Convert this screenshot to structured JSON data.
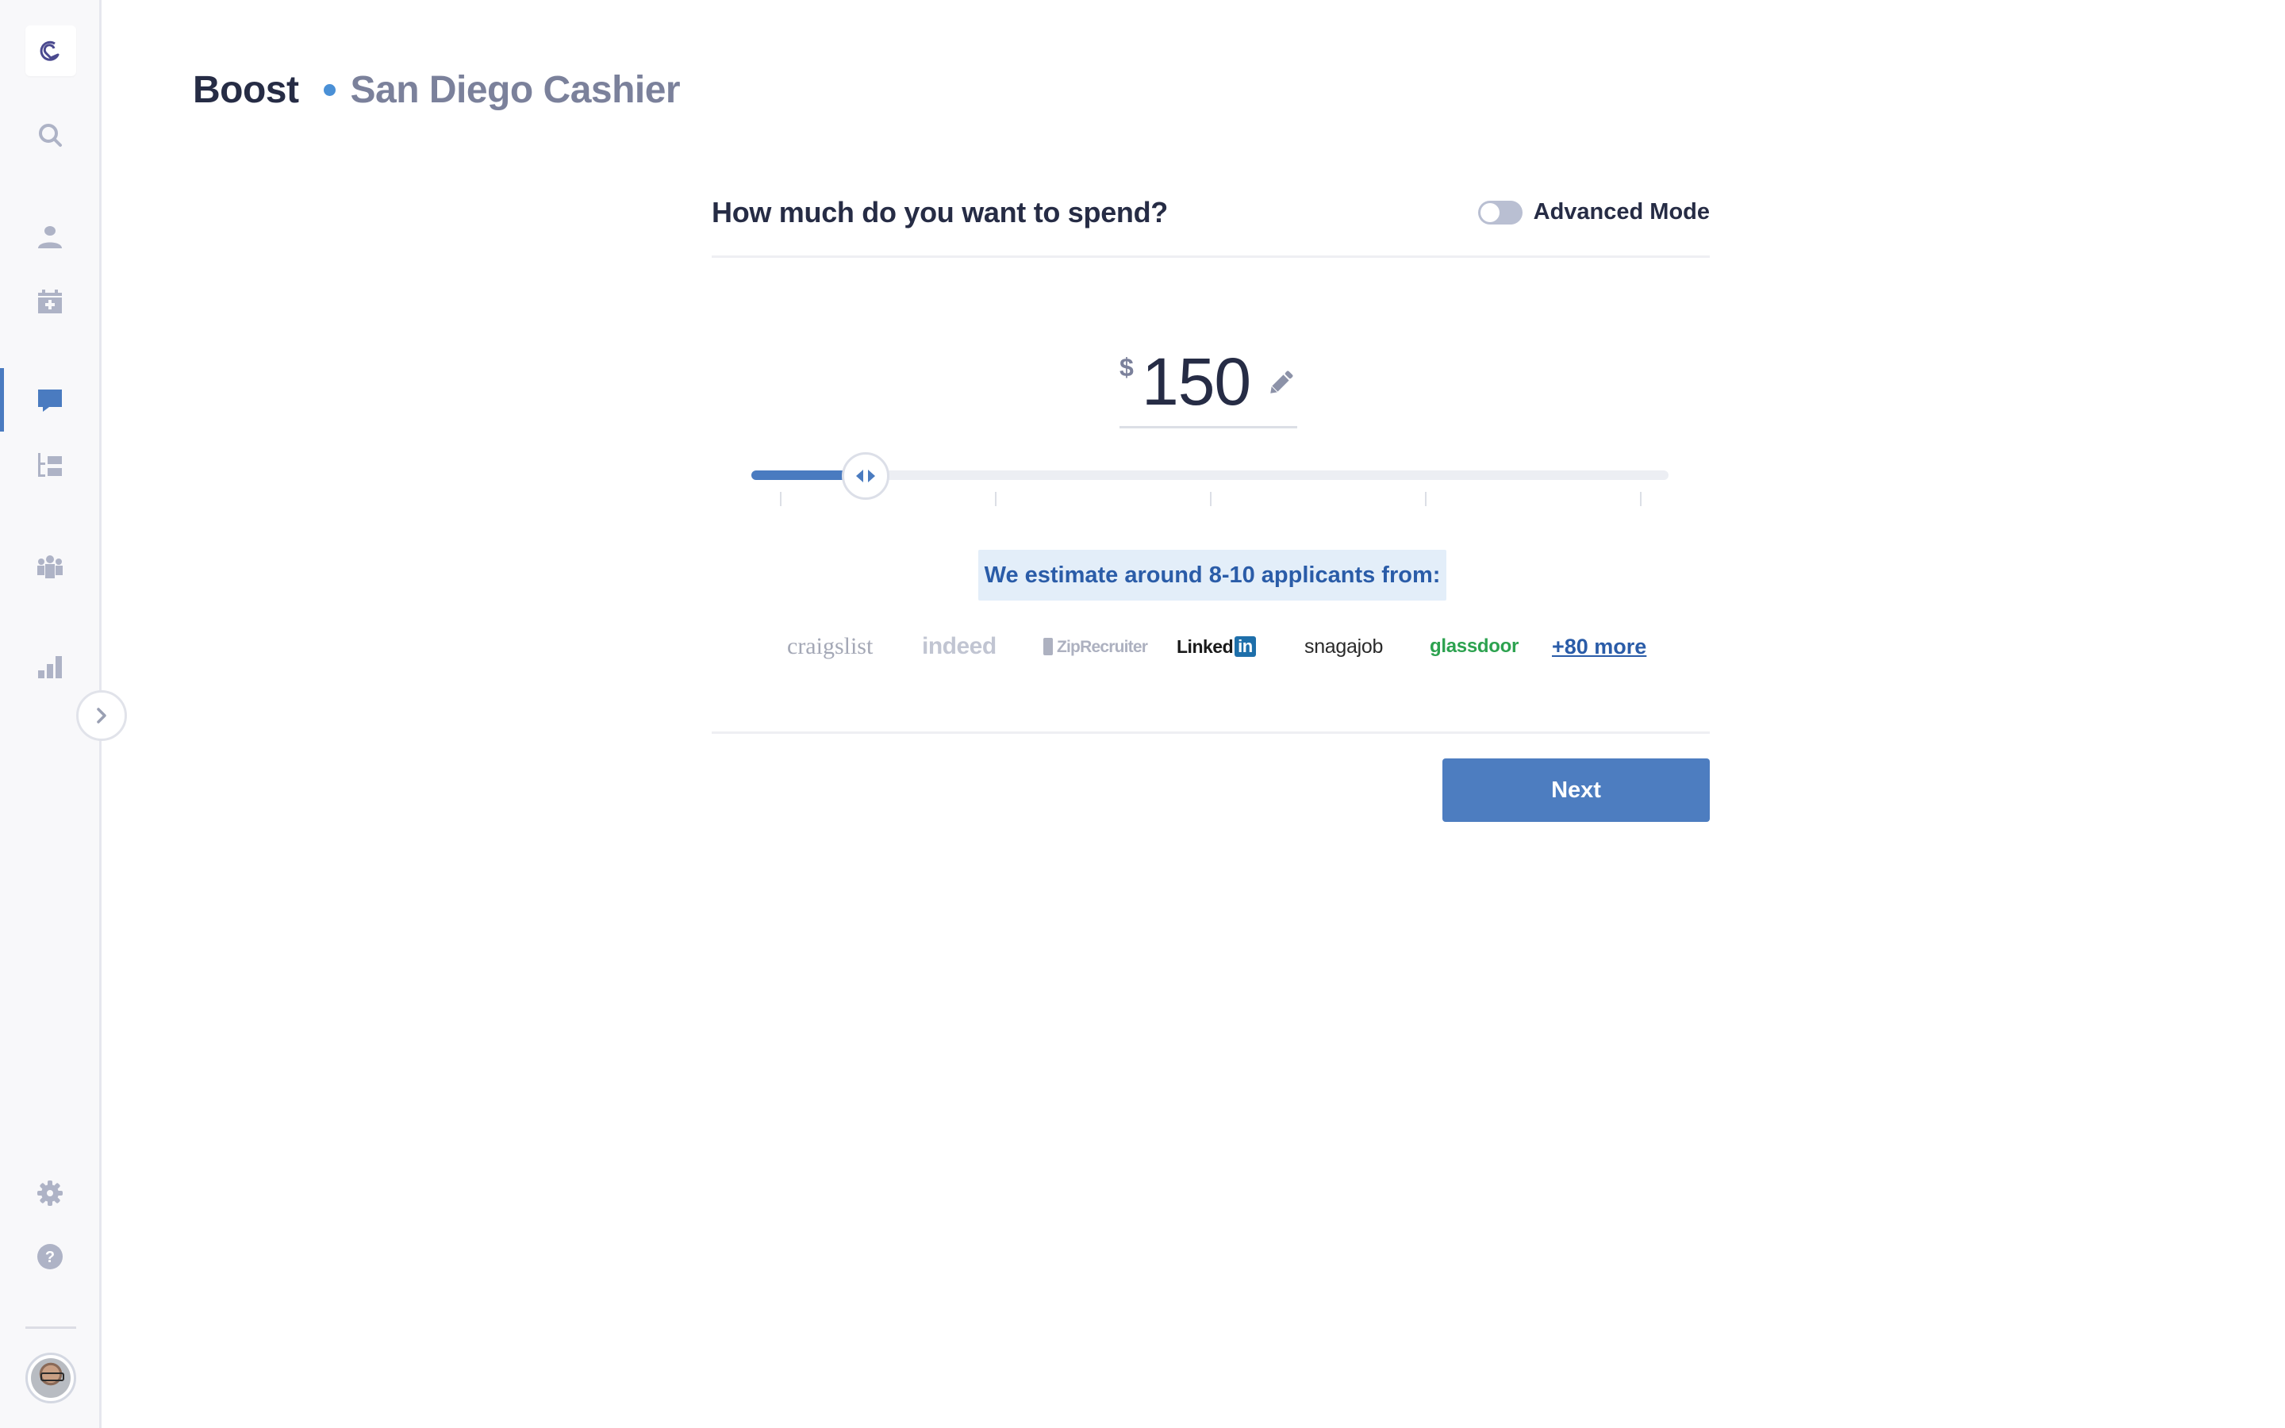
{
  "sidebar": {
    "items": [
      {
        "name": "logo",
        "icon": "brand-logo-icon"
      },
      {
        "name": "search",
        "icon": "search-icon"
      },
      {
        "name": "candidates",
        "icon": "person-icon"
      },
      {
        "name": "calendar",
        "icon": "calendar-plus-icon"
      },
      {
        "name": "messages",
        "icon": "chat-bubble-icon",
        "active": true
      },
      {
        "name": "pipeline",
        "icon": "hierarchy-list-icon"
      },
      {
        "name": "team",
        "icon": "team-icon"
      },
      {
        "name": "reports",
        "icon": "bar-chart-icon"
      },
      {
        "name": "settings",
        "icon": "gear-icon"
      },
      {
        "name": "help",
        "icon": "help-icon"
      }
    ],
    "collapse_icon": "chevron-right-icon"
  },
  "header": {
    "title": "Boost",
    "subtitle": "San Diego Cashier"
  },
  "form": {
    "question": "How much do you want to spend?",
    "advanced_mode_label": "Advanced Mode",
    "advanced_mode_on": false,
    "currency_symbol": "$",
    "amount": "150",
    "slider": {
      "value_fraction": 0.1,
      "tick_count": 5
    },
    "estimate_text": "We estimate around 8-10 applicants from:",
    "job_boards": [
      "craigslist",
      "indeed",
      "ZipRecruiter",
      "Linked",
      "in",
      "snagajob",
      "glassdoor"
    ],
    "more_link": "+80 more",
    "next_label": "Next"
  },
  "colors": {
    "accent": "#4d7dc0",
    "title_dot": "#4a90d6",
    "estimate_bg": "#e3eef9",
    "estimate_text": "#2a5ca8",
    "glassdoor": "#2ca24f",
    "linkedin": "#1e6faa"
  }
}
